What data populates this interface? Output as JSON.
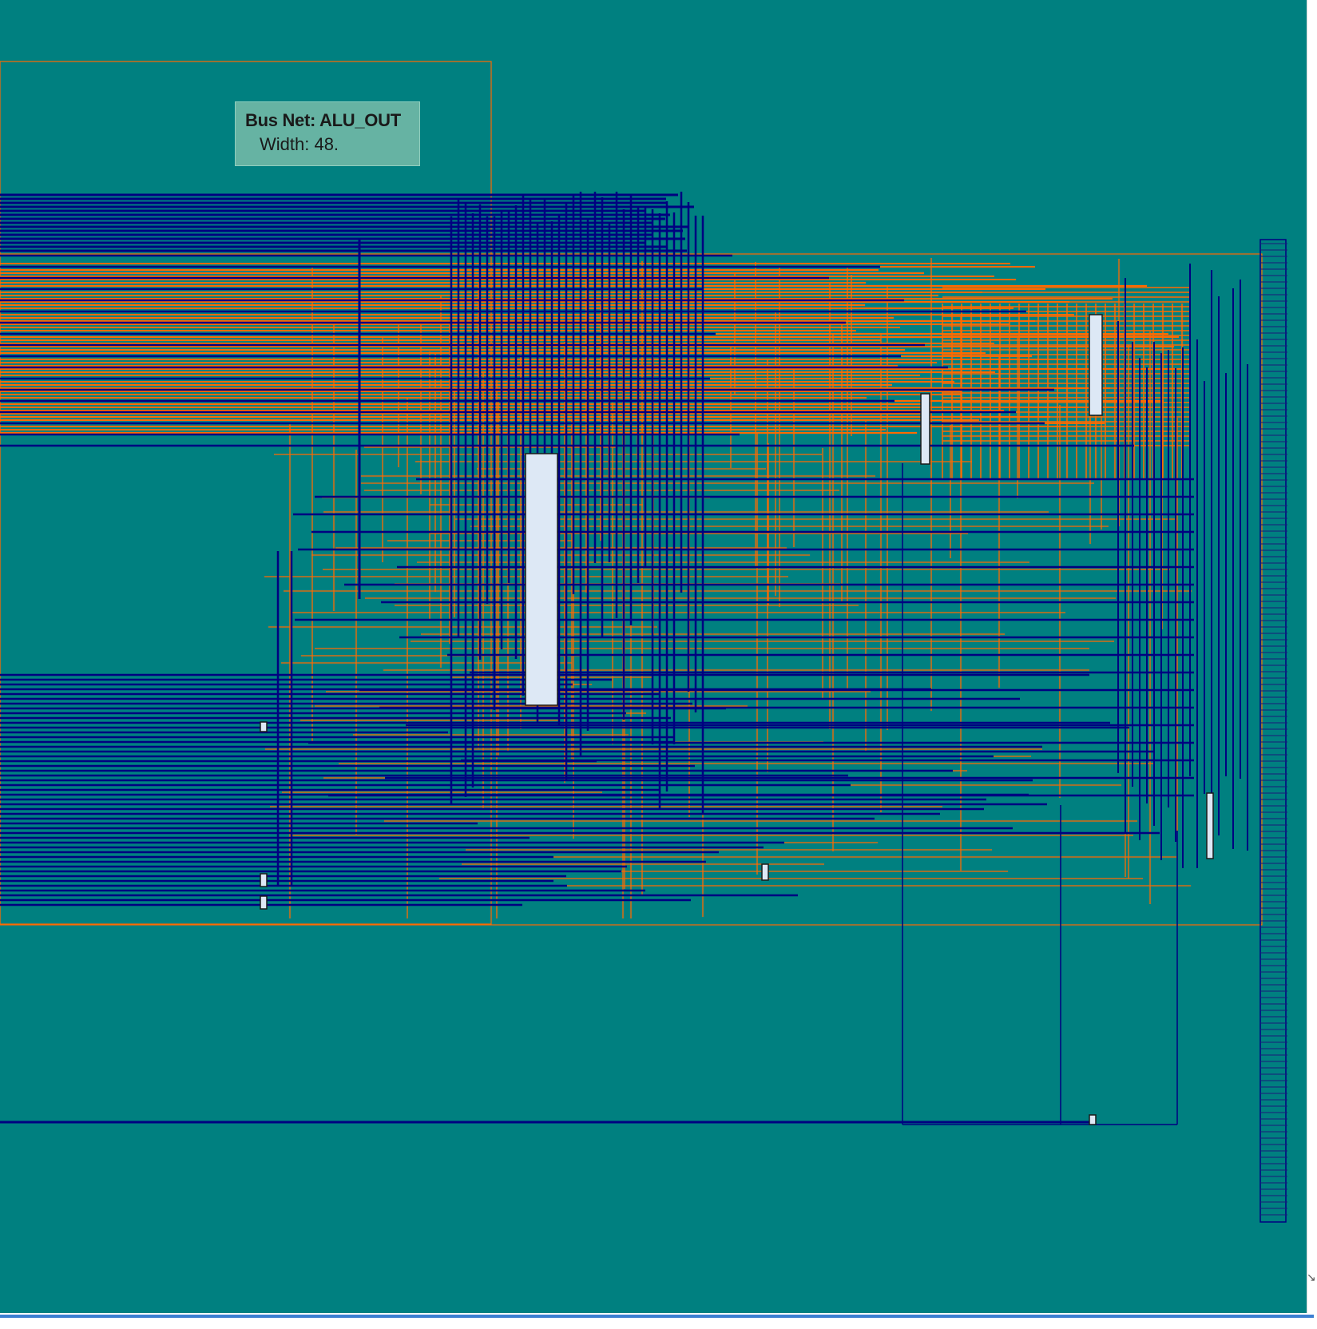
{
  "tooltip": {
    "title": "Bus Net: ALU_OUT",
    "width_label": "Width: 48."
  },
  "colors": {
    "background": "#008080",
    "bus_net": "#000080",
    "wire_highlight": "#ff6a00",
    "cell_fill": "#dde8f5",
    "tooltip_bg": "#66b3a3"
  }
}
